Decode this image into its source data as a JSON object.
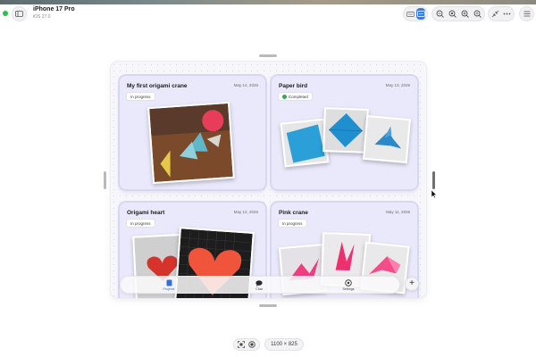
{
  "device": {
    "name": "iPhone 17 Pro",
    "os": "iOS 27.0"
  },
  "toolbar_icons": [
    "sidebar-icon",
    "keyboard-icon",
    "screen-icon",
    "zoom-out-icon",
    "zoom-actual-icon",
    "zoom-in-icon",
    "zoom-fit-icon",
    "shrink-icon",
    "more-icon",
    "menu-icon"
  ],
  "cards": [
    {
      "title": "My first origami crane",
      "date": "May 14, 2026",
      "status": "In progress",
      "completed": false
    },
    {
      "title": "Paper bird",
      "date": "May 13, 2026",
      "status": "Completed",
      "completed": true
    },
    {
      "title": "Origami heart",
      "date": "May 12, 2026",
      "status": "In progress",
      "completed": false
    },
    {
      "title": "Pink crane",
      "date": "May 11, 2026",
      "status": "In progress",
      "completed": false
    }
  ],
  "tabs": [
    {
      "label": "Projects",
      "icon": "doc-icon",
      "active": true
    },
    {
      "label": "Chat",
      "icon": "chat-bubble-icon",
      "active": false
    },
    {
      "label": "Settings",
      "icon": "gear-icon",
      "active": false
    }
  ],
  "add_button_label": "+",
  "canvas_size": "1100 × 825",
  "colors": {
    "accent": "#2f80ed",
    "card_bg": "#e9e9fb",
    "status_green": "#2fbf4a"
  }
}
